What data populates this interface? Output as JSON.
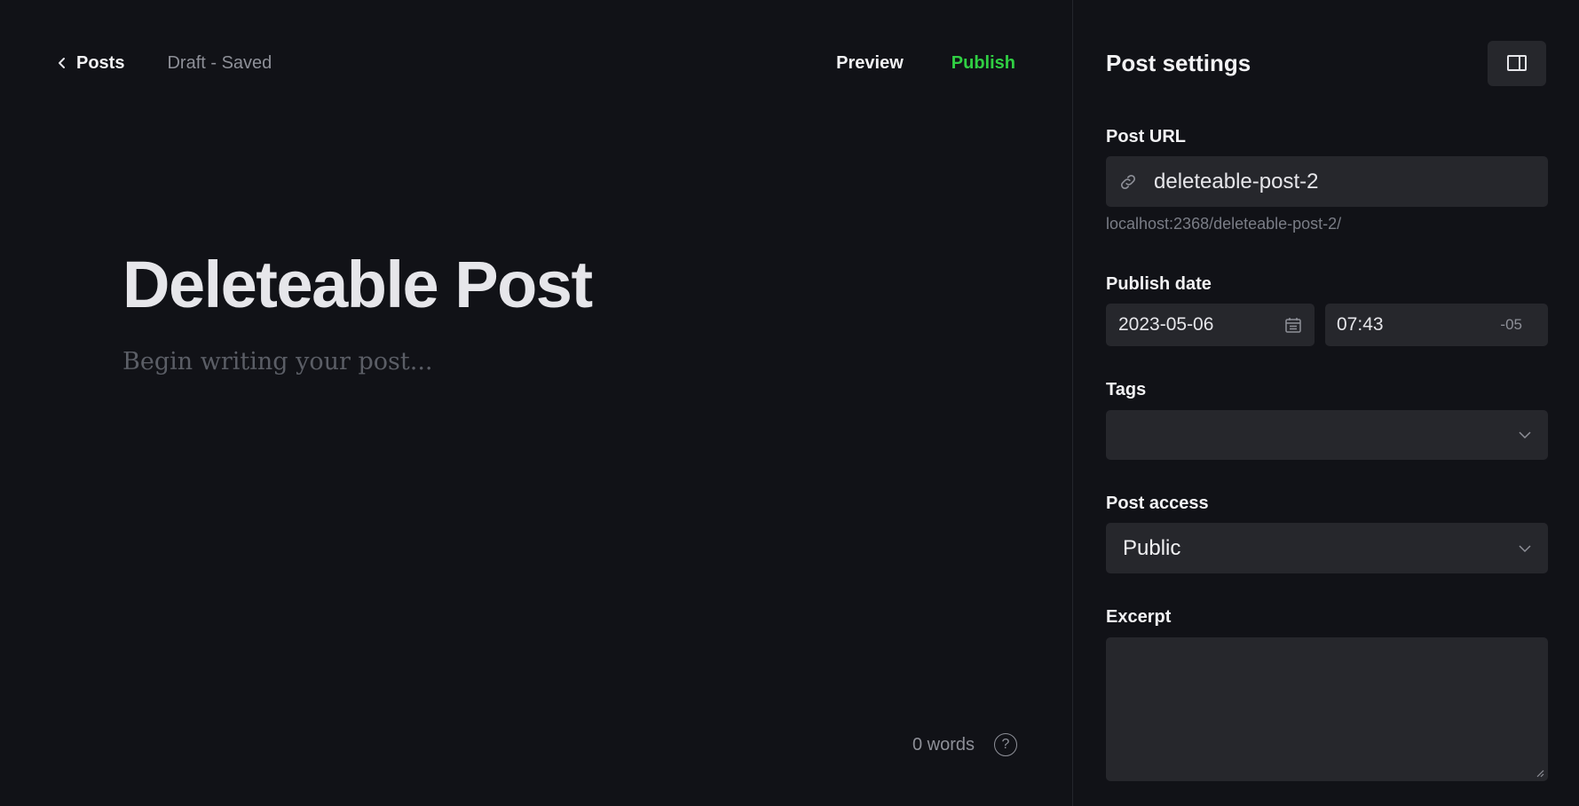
{
  "topbar": {
    "back_label": "Posts",
    "status": "Draft - Saved",
    "preview_label": "Preview",
    "publish_label": "Publish"
  },
  "editor": {
    "title": "Deleteable Post",
    "body_placeholder": "Begin writing your post...",
    "word_count": "0 words",
    "help_glyph": "?"
  },
  "sidebar": {
    "title": "Post settings",
    "post_url": {
      "label": "Post URL",
      "value": "deleteable-post-2",
      "hint": "localhost:2368/deleteable-post-2/"
    },
    "publish_date": {
      "label": "Publish date",
      "date": "2023-05-06",
      "time": "07:43",
      "timezone": "-05"
    },
    "tags": {
      "label": "Tags",
      "value": ""
    },
    "post_access": {
      "label": "Post access",
      "value": "Public"
    },
    "excerpt": {
      "label": "Excerpt",
      "value": ""
    }
  },
  "colors": {
    "background": "#111217",
    "field": "#26272c",
    "publish_accent": "#30cf43",
    "muted_text": "#8e9098"
  },
  "icons": [
    "chevron-left-icon",
    "sidebar-toggle-icon",
    "link-icon",
    "calendar-icon",
    "chevron-down-icon",
    "help-icon",
    "resize-handle-icon"
  ]
}
